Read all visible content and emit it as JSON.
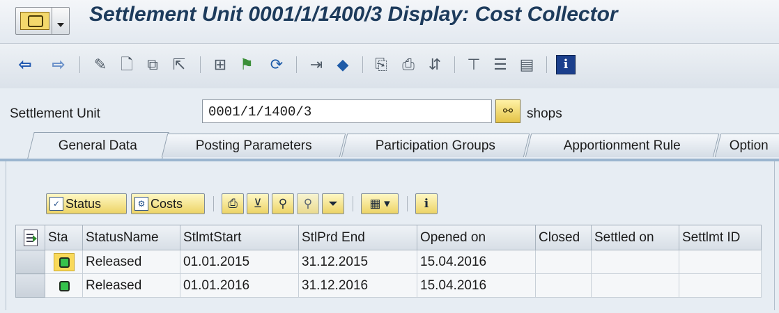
{
  "window": {
    "title": "Settlement Unit 0001/1/1400/3 Display: Cost Collector",
    "system_menu_icon": "sap-system-menu-icon"
  },
  "toolbar": {
    "icons": [
      {
        "name": "back-icon",
        "glyph": "⇦"
      },
      {
        "name": "forward-icon",
        "glyph": "⇨"
      },
      {
        "name": "change-icon",
        "glyph": "✎"
      },
      {
        "name": "create-icon",
        "glyph": "🗋"
      },
      {
        "name": "copy-icon",
        "glyph": "⧉"
      },
      {
        "name": "export-icon",
        "glyph": "⇱"
      },
      {
        "name": "hierarchy-icon",
        "glyph": "⊞"
      },
      {
        "name": "flag-icon",
        "glyph": "⚑"
      },
      {
        "name": "refresh-icon",
        "glyph": "⟳"
      },
      {
        "name": "goto-icon",
        "glyph": "⇥"
      },
      {
        "name": "object-icon",
        "glyph": "◆"
      },
      {
        "name": "documents-icon",
        "glyph": "⎘"
      },
      {
        "name": "print-icon",
        "glyph": "⎙"
      },
      {
        "name": "sort-icon",
        "glyph": "⇵"
      },
      {
        "name": "structure-icon",
        "glyph": "⊤"
      },
      {
        "name": "list-icon",
        "glyph": "☰"
      },
      {
        "name": "layout-icon",
        "glyph": "▤"
      },
      {
        "name": "info-icon",
        "glyph": "i"
      }
    ]
  },
  "header": {
    "settlement_unit_label": "Settlement Unit",
    "settlement_unit_value": "0001/1/1400/3",
    "settlement_unit_description": "shops"
  },
  "tabs": [
    {
      "label": "General Data",
      "active": true
    },
    {
      "label": "Posting Parameters",
      "active": false
    },
    {
      "label": "Participation Groups",
      "active": false
    },
    {
      "label": "Apportionment Rule",
      "active": false
    },
    {
      "label": "Option",
      "active": false
    }
  ],
  "grid_toolbar": {
    "status_label": "Status",
    "costs_label": "Costs"
  },
  "grid": {
    "columns": [
      "Sta",
      "StatusName",
      "StlmtStart",
      "StlPrd End",
      "Opened on",
      "Closed",
      "Settled on",
      "Settlmt ID"
    ],
    "rows": [
      {
        "status_light": "green",
        "status_name": "Released",
        "start": "01.01.2015",
        "end": "31.12.2015",
        "opened_on": "15.04.2016",
        "closed": "",
        "settled_on": "",
        "settlmt_id": ""
      },
      {
        "status_light": "green",
        "status_name": "Released",
        "start": "01.01.2016",
        "end": "31.12.2016",
        "opened_on": "15.04.2016",
        "closed": "",
        "settled_on": "",
        "settlmt_id": ""
      }
    ]
  }
}
